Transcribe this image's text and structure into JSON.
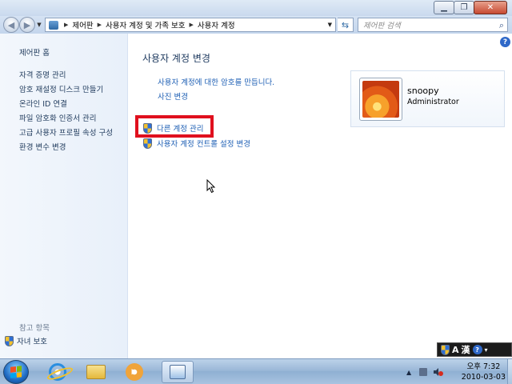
{
  "window": {
    "controls": {
      "minimize": "▁",
      "maximize": "❐",
      "close": "✕"
    }
  },
  "address_bar": {
    "breadcrumbs": [
      "제어판",
      "사용자 계정 및 가족 보호",
      "사용자 계정"
    ],
    "search_placeholder": "제어판 검색"
  },
  "left_pane": {
    "home_label": "제어판 홈",
    "links": [
      "자격 증명 관리",
      "암호 재설정 디스크 만들기",
      "온라인 ID 연결",
      "파일 암호화 인증서 관리",
      "고급 사용자 프로필 속성 구성",
      "환경 변수 변경"
    ],
    "see_also_label": "참고 항목",
    "parental_controls_label": "자녀 보호"
  },
  "main": {
    "title": "사용자 계정 변경",
    "tasks": {
      "create_password": "사용자 계정에 대한 암호를 만듭니다.",
      "change_picture": "사진 변경",
      "manage_accounts": "다른 계정 관리",
      "uac_settings": "사용자 계정 컨트롤 설정 변경"
    },
    "help_label": "?"
  },
  "user": {
    "name": "snoopy",
    "role": "Administrator"
  },
  "taskbar": {
    "language_bar": {
      "input_mode": "A",
      "hanja": "漢",
      "help": "?"
    },
    "clock": {
      "time": "오후 7:32",
      "date": "2010-03-03"
    }
  },
  "colors": {
    "link": "#1e5fb4",
    "highlight_box": "#e0101e",
    "left_pane_bg": "#eef4fb"
  }
}
